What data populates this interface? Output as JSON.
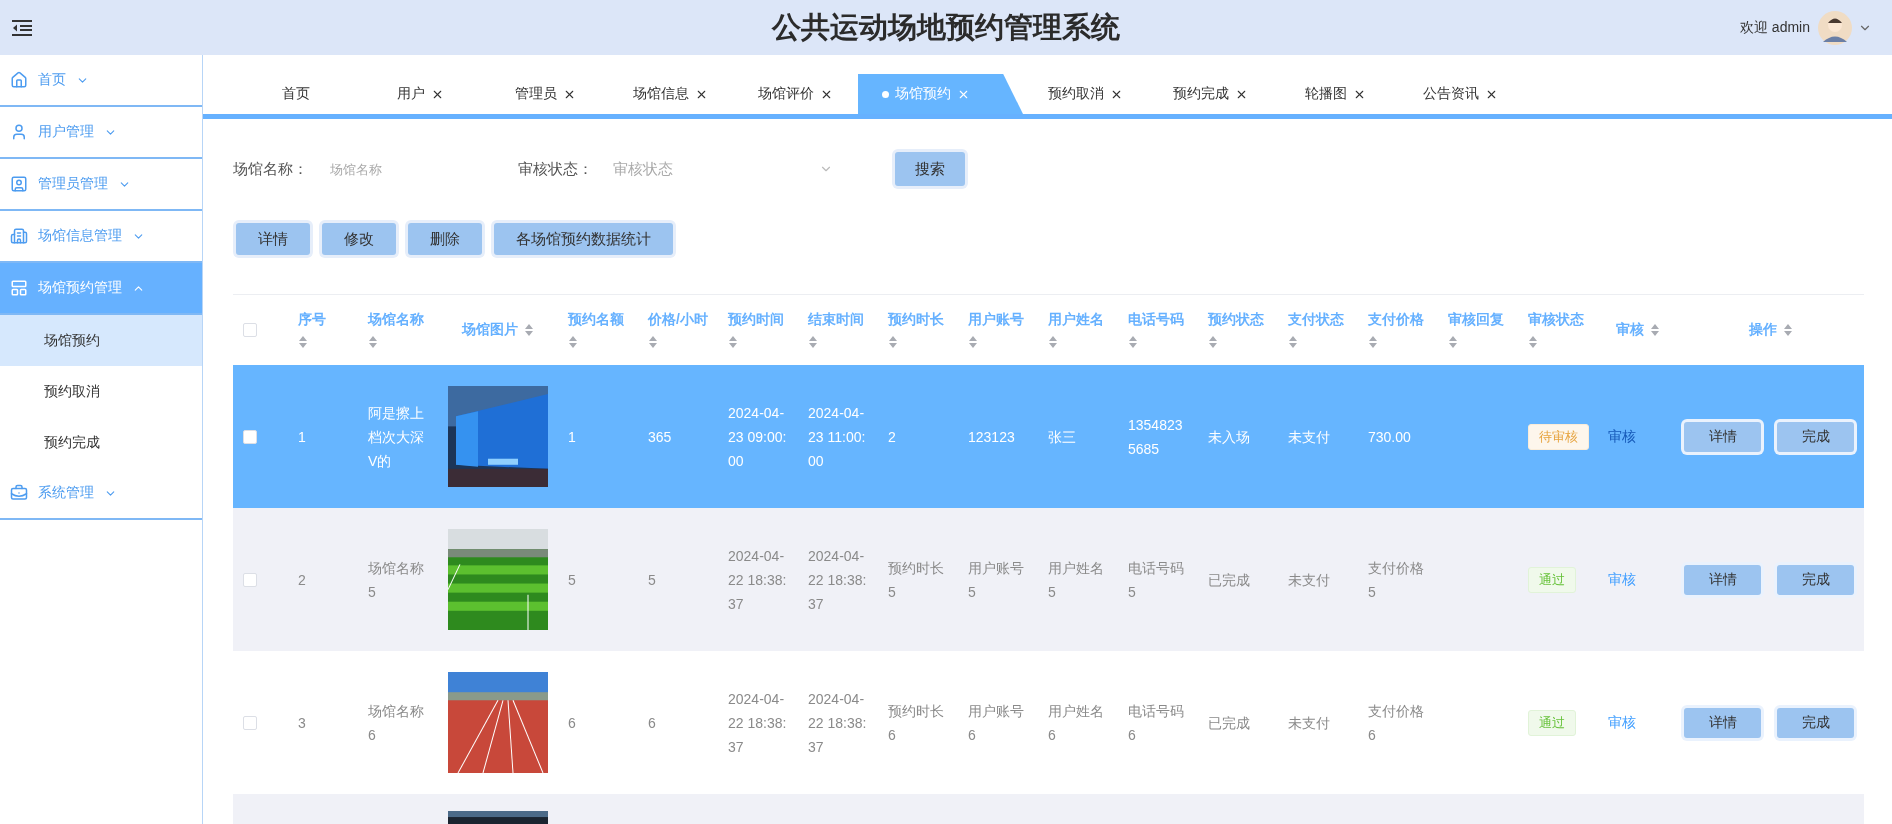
{
  "header": {
    "title": "公共运动场地预约管理系统",
    "welcome": "欢迎 admin"
  },
  "sidebar": {
    "items": [
      {
        "label": "首页",
        "expanded": false
      },
      {
        "label": "用户管理",
        "expanded": false
      },
      {
        "label": "管理员管理",
        "expanded": false
      },
      {
        "label": "场馆信息管理",
        "expanded": false
      },
      {
        "label": "场馆预约管理",
        "expanded": true,
        "children": [
          {
            "label": "场馆预约",
            "selected": true
          },
          {
            "label": "预约取消",
            "selected": false
          },
          {
            "label": "预约完成",
            "selected": false
          }
        ]
      },
      {
        "label": "系统管理",
        "expanded": false
      }
    ]
  },
  "tabs": [
    {
      "label": "首页",
      "selected": false,
      "closable": false
    },
    {
      "label": "用户",
      "selected": false,
      "closable": true
    },
    {
      "label": "管理员",
      "selected": false,
      "closable": true
    },
    {
      "label": "场馆信息",
      "selected": false,
      "closable": true
    },
    {
      "label": "场馆评价",
      "selected": false,
      "closable": true
    },
    {
      "label": "场馆预约",
      "selected": true,
      "closable": true
    },
    {
      "label": "预约取消",
      "selected": false,
      "closable": true
    },
    {
      "label": "预约完成",
      "selected": false,
      "closable": true
    },
    {
      "label": "轮播图",
      "selected": false,
      "closable": true
    },
    {
      "label": "公告资讯",
      "selected": false,
      "closable": true
    }
  ],
  "search": {
    "fields": [
      {
        "kind": "input",
        "label": "场馆名称：",
        "placeholder": "场馆名称"
      },
      {
        "kind": "select",
        "label": "审核状态：",
        "placeholder": "审核状态"
      }
    ],
    "button": "搜索"
  },
  "actions": [
    "详情",
    "修改",
    "删除",
    "各场馆预约数据统计"
  ],
  "table": {
    "all_checked": false,
    "columns": [
      "序号",
      "场馆名称",
      "场馆图片",
      "预约名额",
      "价格/小时",
      "预约时间",
      "结束时间",
      "预约时长",
      "用户账号",
      "用户姓名",
      "电话号码",
      "预约状态",
      "支付状态",
      "支付价格",
      "审核回复",
      "审核状态",
      "审核",
      "操作"
    ],
    "rows": [
      {
        "selected": true,
        "checked": false,
        "no": "1",
        "venue": "阿是擦上档次大深V的",
        "picture": {
          "kind": "picture"
        },
        "quota": "1",
        "price": "365",
        "start": "2024-04-23 09:00:00",
        "end": "2024-04-23 11:00:00",
        "duration": "2",
        "account": "123123",
        "user": "张三",
        "phone": "13548235685",
        "booking_status": "未入场",
        "pay_status": "未支付",
        "pay_price": "730.00",
        "review_status": {
          "text": "待审核",
          "kind": "pending"
        },
        "review_link": "审核",
        "buttons": [
          "详情",
          "完成"
        ]
      },
      {
        "selected": false,
        "checked": false,
        "no": "2",
        "venue": "场馆名称5",
        "picture": {
          "kind": "picture"
        },
        "quota": "5",
        "price": "5",
        "start": "2024-04-22 18:38:37",
        "end": "2024-04-22 18:38:37",
        "duration": "预约时长5",
        "account": "用户账号5",
        "user": "用户姓名5",
        "phone": "电话号码5",
        "booking_status": "已完成",
        "pay_status": "未支付",
        "pay_price": "支付价格5",
        "review_status": {
          "text": "通过",
          "kind": "passed"
        },
        "review_link": "审核",
        "buttons": [
          "详情",
          "完成"
        ]
      },
      {
        "selected": false,
        "checked": false,
        "no": "3",
        "venue": "场馆名称6",
        "picture": {
          "kind": "picture"
        },
        "quota": "6",
        "price": "6",
        "start": "2024-04-22 18:38:37",
        "end": "2024-04-22 18:38:37",
        "duration": "预约时长6",
        "account": "用户账号6",
        "user": "用户姓名6",
        "phone": "电话号码6",
        "booking_status": "已完成",
        "pay_status": "未支付",
        "pay_price": "支付价格6",
        "review_status": {
          "text": "通过",
          "kind": "passed"
        },
        "review_link": "审核",
        "buttons": [
          "详情",
          "完成"
        ]
      },
      {
        "selected": false,
        "picture": {
          "kind": "picture"
        }
      }
    ]
  }
}
